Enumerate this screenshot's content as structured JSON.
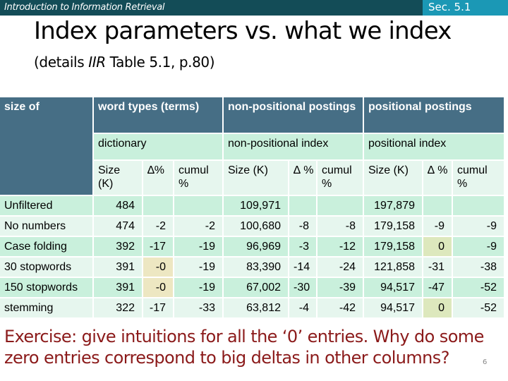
{
  "header": {
    "course": "Introduction to Information Retrieval",
    "section": "Sec. 5.1",
    "colors": {
      "bar": "#134c57",
      "section_bg": "#1b98b5"
    }
  },
  "slide": {
    "title": "Index parameters vs. what we index",
    "subtitle_pre": "(details ",
    "subtitle_italic": "IIR",
    "subtitle_post": " Table 5.1, p.80)"
  },
  "table": {
    "colors": {
      "header": "#466e85",
      "row_dark": "#c9f0dc",
      "row_light": "#e6f6ee",
      "highlight": "#ede7c2"
    },
    "top_headers": {
      "size_of": "size of",
      "word_types": "word types (terms)",
      "nonpositional": "non-positional postings",
      "positional": "positional postings"
    },
    "second_headers": {
      "dictionary": "dictionary",
      "nonpositional_index": "non-positional index",
      "positional_index": "positional index"
    },
    "third_headers": {
      "dict_size": "Size (K)",
      "dict_delta": "∆%",
      "dict_cumul": "cumul %",
      "np_size": "Size (K)",
      "np_delta": "∆ %",
      "np_cumul": "cumul %",
      "p_size": "Size (K)",
      "p_delta": "∆ %",
      "p_cumul": "cumul %"
    },
    "rows": [
      {
        "label": "Unfiltered",
        "dict_size": "484",
        "dict_delta": "",
        "dict_cumul": "",
        "np_size": "109,971",
        "np_delta": "",
        "np_cumul": "",
        "p_size": "197,879",
        "p_delta": "",
        "p_cumul": ""
      },
      {
        "label": "No numbers",
        "dict_size": "474",
        "dict_delta": "-2",
        "dict_cumul": "-2",
        "np_size": "100,680",
        "np_delta": "-8",
        "np_cumul": "-8",
        "p_size": "179,158",
        "p_delta": "-9",
        "p_cumul": "-9"
      },
      {
        "label": "Case folding",
        "dict_size": "392",
        "dict_delta": "-17",
        "dict_cumul": "-19",
        "np_size": "96,969",
        "np_delta": "-3",
        "np_cumul": "-12",
        "p_size": "179,158",
        "p_delta": "0",
        "p_cumul": "-9"
      },
      {
        "label": "30 stopwords",
        "dict_size": "391",
        "dict_delta": "-0",
        "dict_cumul": "-19",
        "np_size": "83,390",
        "np_delta": "-14",
        "np_cumul": "-24",
        "p_size": "121,858",
        "p_delta": "-31",
        "p_cumul": "-38"
      },
      {
        "label": "150 stopwords",
        "dict_size": "391",
        "dict_delta": "-0",
        "dict_cumul": "-19",
        "np_size": "67,002",
        "np_delta": "-30",
        "np_cumul": "-39",
        "p_size": "94,517",
        "p_delta": "-47",
        "p_cumul": "-52"
      },
      {
        "label": "stemming",
        "dict_size": "322",
        "dict_delta": "-17",
        "dict_cumul": "-33",
        "np_size": "63,812",
        "np_delta": "-4",
        "np_cumul": "-42",
        "p_size": "94,517",
        "p_delta": "0",
        "p_cumul": "-52"
      }
    ]
  },
  "exercise": {
    "text": "Exercise: give intuitions for all the ‘0’ entries. Why do some zero entries correspond to big deltas in other columns?",
    "color": "#8b1a1a"
  },
  "page_number": "6"
}
